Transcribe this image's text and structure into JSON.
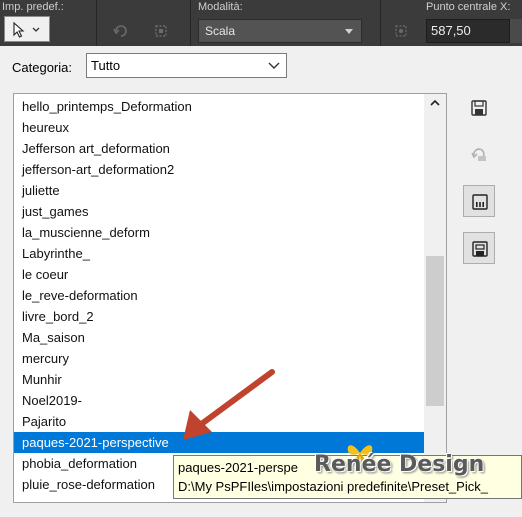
{
  "toolbar": {
    "preset_label": "Imp. predef.:",
    "mode_label": "Modalità:",
    "mode_value": "Scala",
    "center_x_label": "Punto centrale X:",
    "center_x_value": "587,50"
  },
  "dialog": {
    "category_label": "Categoria:",
    "category_value": "Tutto",
    "items": [
      "hello_printemps_Deformation",
      "heureux",
      "Jefferson art_deformation",
      "jefferson-art_deformation2",
      "juliette",
      "just_games",
      "la_muscienne_deform",
      "Labyrinthe_",
      "le coeur",
      "le_reve-deformation",
      "livre_bord_2",
      "Ma_saison",
      "mercury",
      "Munhir",
      "Noel2019-",
      "Pajarito",
      "paques-2021-perspective",
      "phobia_deformation",
      "pluie_rose-deformation"
    ],
    "selected_index": 16
  },
  "tooltip": {
    "line1": "paques-2021-perspe",
    "line2": "D:\\My PsPFIles\\impostazioni predefinite\\Preset_Pick_"
  },
  "watermark": "Renée Design",
  "colors": {
    "selection": "#0078d7",
    "toolbar_bg": "#3b3b3b",
    "arrow": "#c0432e",
    "tooltip_bg": "#ffffe1"
  }
}
